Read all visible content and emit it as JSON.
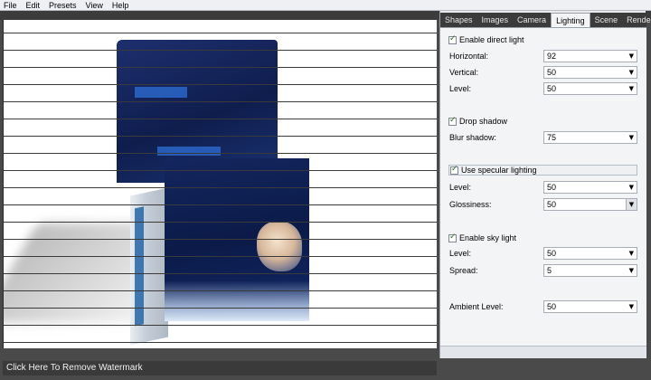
{
  "menu": [
    "File",
    "Edit",
    "Presets",
    "View",
    "Help"
  ],
  "tabs": [
    "Shapes",
    "Images",
    "Camera",
    "Lighting",
    "Scene",
    "Render"
  ],
  "active_tab": "Lighting",
  "lighting": {
    "direct_light": {
      "label": "Enable direct light",
      "checked": true,
      "horizontal_label": "Horizontal:",
      "horizontal": "92",
      "vertical_label": "Vertical:",
      "vertical": "50",
      "level_label": "Level:",
      "level": "50"
    },
    "drop_shadow": {
      "label": "Drop shadow",
      "checked": true,
      "blur_label": "Blur shadow:",
      "blur": "75"
    },
    "specular": {
      "label": "Use specular lighting",
      "checked": true,
      "level_label": "Level:",
      "level": "50",
      "glossiness_label": "Glossiness:",
      "glossiness": "50"
    },
    "sky_light": {
      "label": "Enable sky light",
      "checked": true,
      "level_label": "Level:",
      "level": "50",
      "spread_label": "Spread:",
      "spread": "5"
    },
    "ambient_label": "Ambient Level:",
    "ambient": "50"
  },
  "watermark_text": "Click Here To Remove Watermark",
  "colors": {
    "box_blue": "#13265e",
    "accent_blue": "#2a66c8",
    "panel_bg": "#f3f4f6",
    "check_green": "#1e6b1e"
  }
}
